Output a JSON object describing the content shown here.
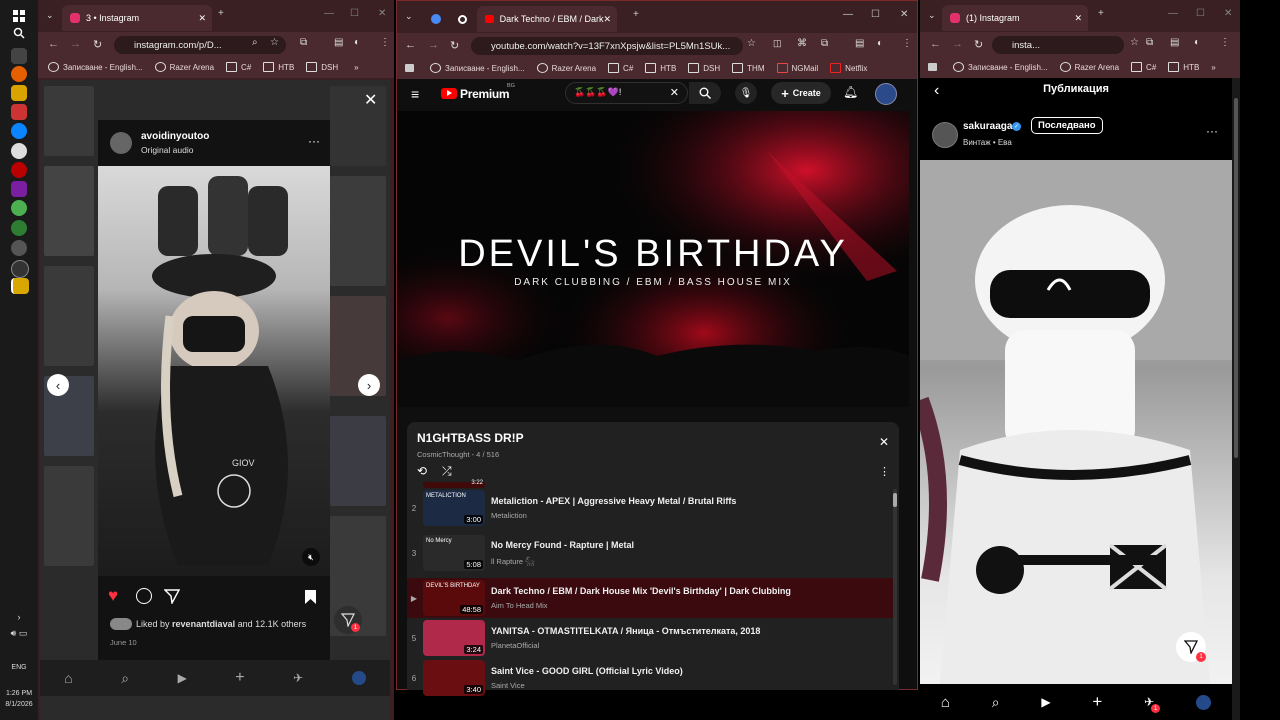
{
  "taskbar": {
    "time": "1:26 PM",
    "date": "8/1/2026",
    "lang": "ENG"
  },
  "left_window": {
    "tab_title": "3 • Instagram",
    "url": "instagram.com/p/D...",
    "bookmarks": [
      "Записване - English...",
      "Razer Arena",
      "C#",
      "HTB",
      "DSH"
    ],
    "post": {
      "username": "avoidinyoutoo",
      "audio": "Original audio",
      "liked_by_prefix": "Liked by",
      "liked_by_user": "revenantdiaval",
      "liked_by_suffix": "and 12.1K others",
      "date": "June 10",
      "overlay_text": "GIOV"
    },
    "nav_badge": "1"
  },
  "youtube_window": {
    "tab_title": "Dark Techno / EBM / Dark",
    "url": "youtube.com/watch?v=13F7xnXpsjw&list=PL5Mn1SUk...",
    "bookmarks": [
      "Записване - English...",
      "Razer Arena",
      "C#",
      "HTB",
      "DSH",
      "THM",
      "NGMail",
      "Netflix"
    ],
    "logo": "Premium",
    "logo_badge": "BG",
    "search_value": "🍒🍒🍒💜!",
    "create_label": "Create",
    "video": {
      "title": "DEVIL'S BIRTHDAY",
      "subtitle": "DARK CLUBBING / EBM / BASS HOUSE MIX"
    },
    "playlist": {
      "title": "N1GHTBASS DR!P",
      "meta": "CosmicThought - 4 / 516",
      "top_partial_duration": "3:22",
      "items": [
        {
          "index": "2",
          "title": "Metaliction - APEX | Aggressive Heavy Metal / Brutal Riffs",
          "channel": "Metaliction",
          "duration": "3:00",
          "thumb_color": "#1c2a44",
          "thumb_label": "METALICTION"
        },
        {
          "index": "3",
          "title": "No Mercy Found - Rapture | Metal",
          "channel": "ll Rapture 𓃵",
          "duration": "5:08",
          "thumb_color": "#2a2a2a",
          "thumb_label": "No Mercy"
        },
        {
          "index": "▶",
          "title": "Dark Techno / EBM / Dark House Mix 'Devil's Birthday' | Dark Clubbing",
          "channel": "Aim To Head Mix",
          "duration": "48:58",
          "thumb_color": "#5a0a0a",
          "thumb_label": "DEVIL'S BIRTHDAY"
        },
        {
          "index": "5",
          "title": "YANITSA - OTMASTITELKATA / Яница - Отмъстителката, 2018",
          "channel": "PlanetaOfficial",
          "duration": "3:24",
          "thumb_color": "#b0284a",
          "thumb_label": ""
        },
        {
          "index": "6",
          "title": "Saint Vice - GOOD GIRL (Official Lyric Video)",
          "channel": "Saint Vice",
          "duration": "3:40",
          "thumb_color": "#6a0e12",
          "thumb_label": ""
        }
      ]
    }
  },
  "right_window": {
    "tab_title": "(1) Instagram",
    "url": "insta...",
    "bookmarks": [
      "Записване - English...",
      "Razer Arena",
      "C#",
      "HTB"
    ],
    "header_title": "Публикация",
    "username": "sakuraaga",
    "follow_label": "Последвано",
    "subtitle": "Винтаж • Ева",
    "badge": "1"
  }
}
